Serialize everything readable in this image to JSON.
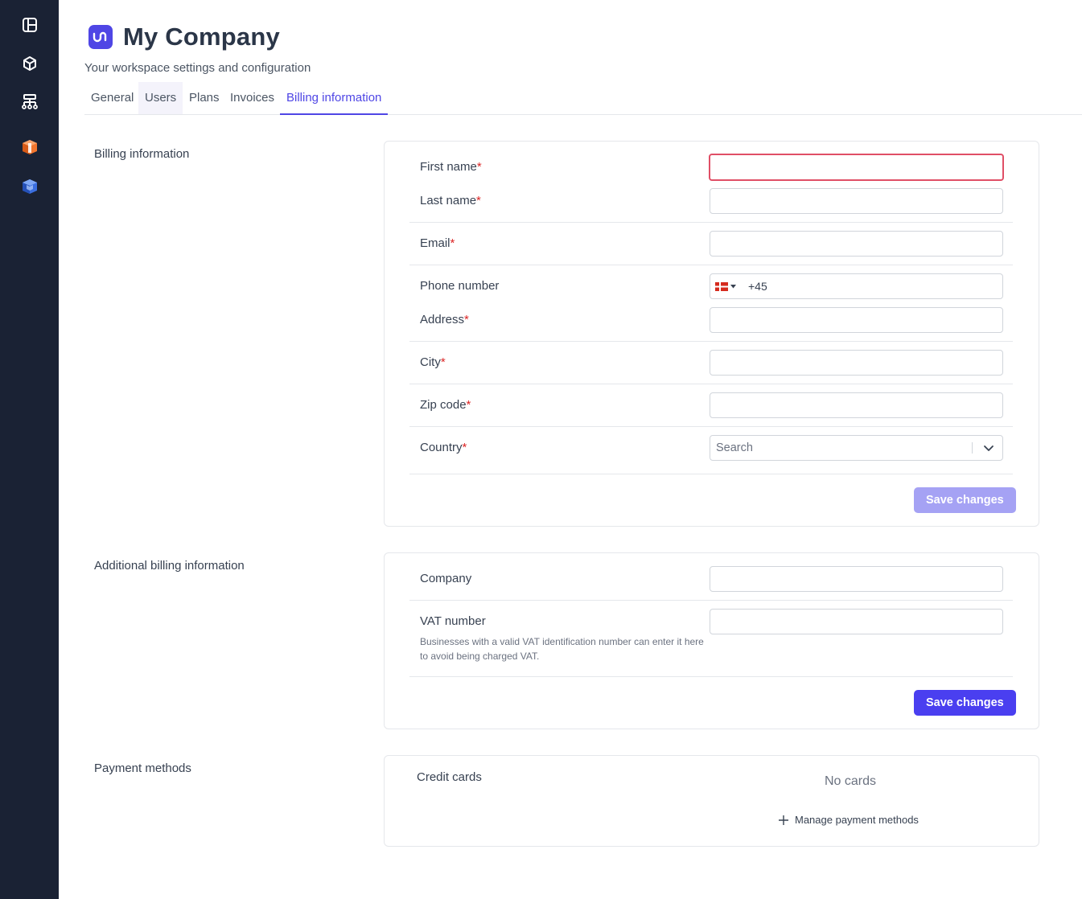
{
  "sidebar": {
    "items": [
      {
        "icon": "layout-icon"
      },
      {
        "icon": "cube-icon"
      },
      {
        "icon": "hierarchy-icon"
      },
      {
        "icon": "orange-box-logo-icon"
      },
      {
        "icon": "blue-box-logo-icon"
      }
    ]
  },
  "header": {
    "title": "My Company",
    "subtitle": "Your workspace settings and configuration",
    "logo_icon": "uniform-logo-icon",
    "brand_color": "#4f46e5"
  },
  "tabs": [
    {
      "label": "General",
      "active": false
    },
    {
      "label": "Users",
      "active": false,
      "hovered": true
    },
    {
      "label": "Plans",
      "active": false
    },
    {
      "label": "Invoices",
      "active": false
    },
    {
      "label": "Billing information",
      "active": true
    }
  ],
  "billing": {
    "section_label": "Billing information",
    "fields": {
      "first_name": {
        "label": "First name",
        "required": "*",
        "value": "",
        "invalid": true
      },
      "last_name": {
        "label": "Last name",
        "required": "*",
        "value": ""
      },
      "email": {
        "label": "Email",
        "required": "*",
        "value": ""
      },
      "phone": {
        "label": "Phone number",
        "country_flag": "dk-flag-icon",
        "dial_code": "+45"
      },
      "address": {
        "label": "Address",
        "required": "*",
        "value": ""
      },
      "city": {
        "label": "City",
        "required": "*",
        "value": ""
      },
      "zip": {
        "label": "Zip code",
        "required": "*",
        "value": ""
      },
      "country": {
        "label": "Country",
        "required": "*",
        "placeholder": "Search"
      }
    },
    "save_label": "Save changes",
    "save_disabled": true
  },
  "additional": {
    "section_label": "Additional billing information",
    "company_label": "Company",
    "vat_label": "VAT number",
    "vat_hint": "Businesses with a valid VAT identification number can enter it here to avoid being charged VAT.",
    "save_label": "Save changes"
  },
  "payment": {
    "section_label": "Payment methods",
    "credit_cards_label": "Credit cards",
    "empty_text": "No cards",
    "manage_label": "Manage payment methods"
  }
}
